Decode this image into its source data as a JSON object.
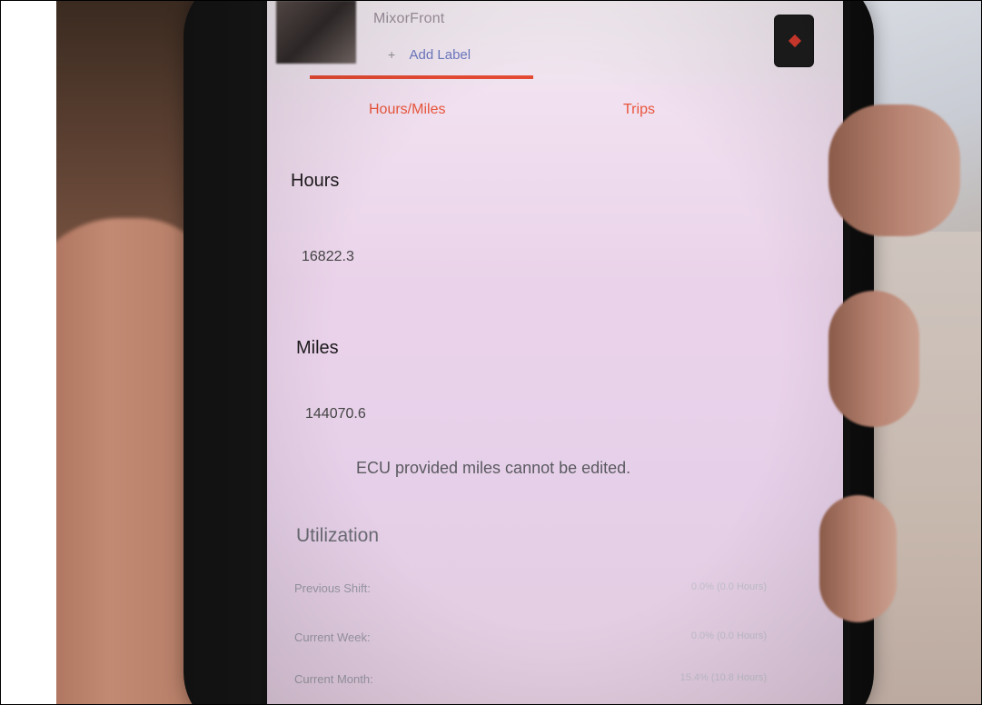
{
  "vehicle": {
    "name": "MixorFront",
    "add_label": "Add Label"
  },
  "tabs": [
    {
      "label": "Hours/Miles",
      "active": true
    },
    {
      "label": "Trips",
      "active": false
    }
  ],
  "hours": {
    "label": "Hours",
    "value": "16822.3"
  },
  "miles": {
    "label": "Miles",
    "value": "144070.6",
    "note": "ECU provided miles cannot be edited."
  },
  "utilization": {
    "label": "Utilization",
    "rows": [
      {
        "label": "Previous Shift:",
        "value": "0.0% (0.0 Hours)"
      },
      {
        "label": "Current Week:",
        "value": "0.0% (0.0 Hours)"
      },
      {
        "label": "Current Month:",
        "value": "15.4% (10.8 Hours)"
      }
    ]
  },
  "colors": {
    "accent": "#e8553a",
    "screen_background": "#ead3ea"
  }
}
